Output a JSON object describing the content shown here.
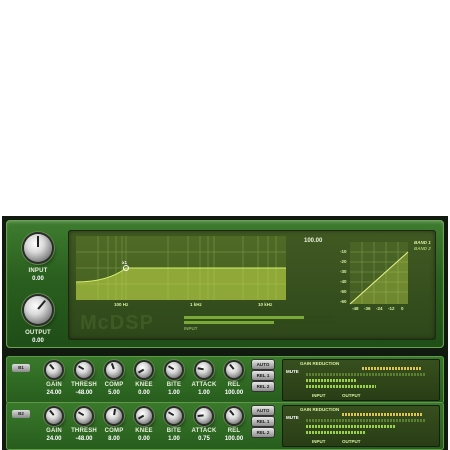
{
  "main": {
    "input_label": "INPUT",
    "input_value": "0.00",
    "output_label": "OUTPUT",
    "output_value": "0.00",
    "logo": "McDSP",
    "eq_freq_labels": [
      "100 Hz",
      "1 kHz",
      "10 kHz"
    ],
    "band_point_label": "x1",
    "threshold_readout": "100.00",
    "band_legend": [
      "BAND 1",
      "BAND 2"
    ],
    "transfer_y_ticks": [
      "-10",
      "-20",
      "-30",
      "-40",
      "-50",
      "-60"
    ],
    "transfer_x_ticks": [
      "-48",
      "-36",
      "-24",
      "-12",
      "0"
    ],
    "meter_label": "INPUT"
  },
  "bands": [
    {
      "band_button": "B1",
      "controls": [
        {
          "label": "GAIN",
          "value": "24.00"
        },
        {
          "label": "THRESH",
          "value": "-48.00"
        },
        {
          "label": "COMP",
          "value": "5.00"
        },
        {
          "label": "KNEE",
          "value": "0.00"
        },
        {
          "label": "BITE",
          "value": "1.00"
        },
        {
          "label": "ATTACK",
          "value": "1.00"
        },
        {
          "label": "REL",
          "value": "100.00"
        }
      ],
      "modes": [
        "AUTO",
        "REL 1",
        "REL 2"
      ],
      "gain_reduction_label": "GAIN REDUCTION",
      "mute_label": "MUTE",
      "input_label": "INPUT",
      "output_label": "OUTPUT"
    },
    {
      "band_button": "B2",
      "controls": [
        {
          "label": "GAIN",
          "value": "24.00"
        },
        {
          "label": "THRESH",
          "value": "-48.00"
        },
        {
          "label": "COMP",
          "value": "8.00"
        },
        {
          "label": "KNEE",
          "value": "0.00"
        },
        {
          "label": "BITE",
          "value": "1.00"
        },
        {
          "label": "ATTACK",
          "value": "0.75"
        },
        {
          "label": "REL",
          "value": "100.00"
        }
      ],
      "modes": [
        "AUTO",
        "REL 1",
        "REL 2"
      ],
      "gain_reduction_label": "GAIN REDUCTION",
      "mute_label": "MUTE",
      "input_label": "INPUT",
      "output_label": "OUTPUT"
    }
  ]
}
